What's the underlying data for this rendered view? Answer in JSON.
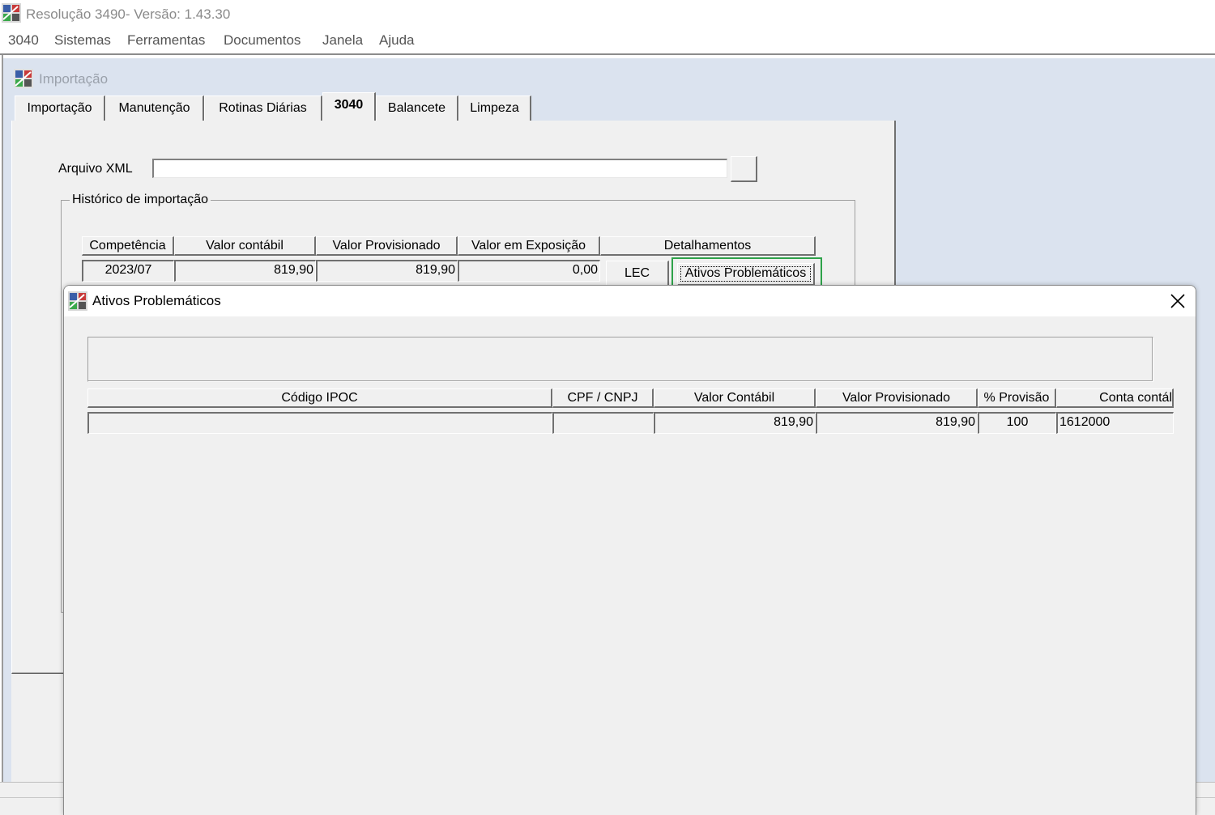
{
  "app": {
    "title": "Resolução 3490- Versão: 1.43.30"
  },
  "menu": {
    "items": [
      "3040",
      "Sistemas",
      "Ferramentas",
      "Documentos",
      "Janela",
      "Ajuda"
    ]
  },
  "child_window": {
    "title": "Importação"
  },
  "tabs": [
    {
      "label": "Importação",
      "active": false
    },
    {
      "label": "Manutenção",
      "active": false
    },
    {
      "label": "Rotinas Diárias",
      "active": false
    },
    {
      "label": "3040",
      "active": true
    },
    {
      "label": "Balancete",
      "active": false
    },
    {
      "label": "Limpeza",
      "active": false
    }
  ],
  "import_form": {
    "xml_label": "Arquivo XML",
    "xml_value": "",
    "group_title": "Histórico de importação",
    "columns": [
      "Competência",
      "Valor contábil",
      "Valor Provisionado",
      "Valor em Exposição",
      "Detalhamentos"
    ],
    "row": {
      "competencia": "2023/07",
      "valor_contabil": "819,90",
      "valor_provisionado": "819,90",
      "valor_exposicao": "0,00",
      "lec_label": "LEC",
      "ativos_label": "Ativos Problemáticos"
    }
  },
  "dialog": {
    "title": "Ativos Problemáticos",
    "columns": [
      "Código IPOC",
      "CPF / CNPJ",
      "Valor Contábil",
      "Valor Provisionado",
      "% Provisão",
      "Conta contál"
    ],
    "row": {
      "codigo_ipoc": "",
      "cpf_cnpj": "",
      "valor_contabil": "819,90",
      "valor_provisionado": "819,90",
      "provisao": "100",
      "conta_contabil": "1612000"
    }
  },
  "colors": {
    "highlight": "#2ea24a",
    "panel": "#f0f0f0",
    "mdi_background": "#dbe3ef"
  },
  "icons": [
    "app-icon",
    "child-window-icon",
    "dialog-icon",
    "close-icon"
  ]
}
